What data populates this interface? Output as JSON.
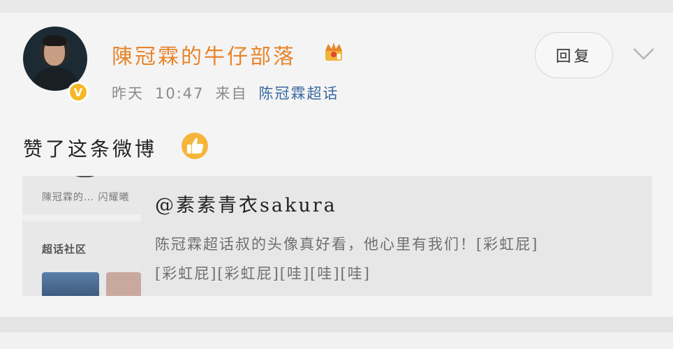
{
  "post": {
    "username": "陳冠霖的牛仔部落",
    "verified_badge": "V",
    "time_label": "昨天",
    "time": "10:47",
    "source_prefix": "来自",
    "source": "陈冠霖超话",
    "reply_label": "回复",
    "action_text": "赞了这条微博"
  },
  "quoted": {
    "author": "@素素青衣sakura",
    "text_line1": "陈冠霖超话叔的头像真好看，他心里有我们！[彩虹屁]",
    "text_line2": "[彩虹屁][彩虹屁][哇][哇][哇]"
  },
  "background_panel": {
    "caption": "陳冠霖的… 闪耀曦",
    "heading": "超话社区"
  },
  "icons": {
    "crown": "crown-icon",
    "thumbs_up": "thumbs-up-icon",
    "chevron": "chevron-down-icon"
  },
  "colors": {
    "username": "#e8842a",
    "source_link": "#3b6aa0",
    "badge": "#f5b825"
  }
}
